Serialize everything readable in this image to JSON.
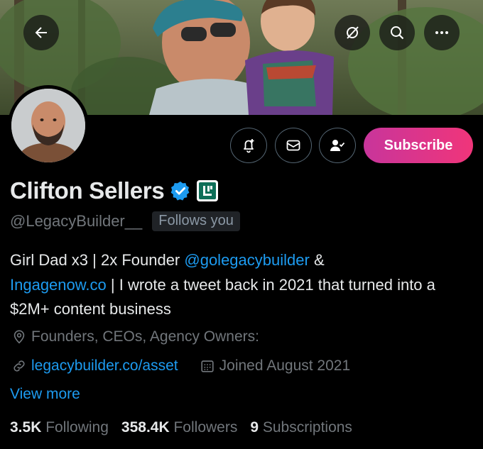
{
  "profile": {
    "name": "Clifton Sellers",
    "handle": "@LegacyBuilder__",
    "follows_you": "Follows you",
    "bio_parts": {
      "p1": "Girl Dad x3 | 2x Founder ",
      "mention": "@golegacybuilder",
      "p2": " &",
      "link1": "Ingagenow.co",
      "p3": " | I wrote a tweet back in 2021 that turned into a $2M+ content business"
    },
    "location": "Founders, CEOs, Agency Owners:",
    "website": "legacybuilder.co/asset",
    "joined": "Joined August 2021",
    "view_more": "View more"
  },
  "actions": {
    "subscribe_label": "Subscribe"
  },
  "stats": {
    "following_count": "3.5K",
    "following_label": "Following",
    "followers_count": "358.4K",
    "followers_label": "Followers",
    "subscriptions_count": "9",
    "subscriptions_label": "Subscriptions"
  },
  "colors": {
    "link": "#1d9bf0",
    "verified": "#1d9bf0",
    "subscribe_start": "#c8359b",
    "subscribe_end": "#f0357a",
    "affiliate_badge": "#0e6f58"
  },
  "icons": {
    "back": "arrow-left-icon",
    "grok": "grok-icon",
    "search": "search-icon",
    "more": "more-icon",
    "notify": "bell-plus-icon",
    "message": "envelope-icon",
    "follow": "person-check-icon",
    "location": "location-pin-icon",
    "website": "link-icon",
    "joined": "calendar-icon"
  }
}
